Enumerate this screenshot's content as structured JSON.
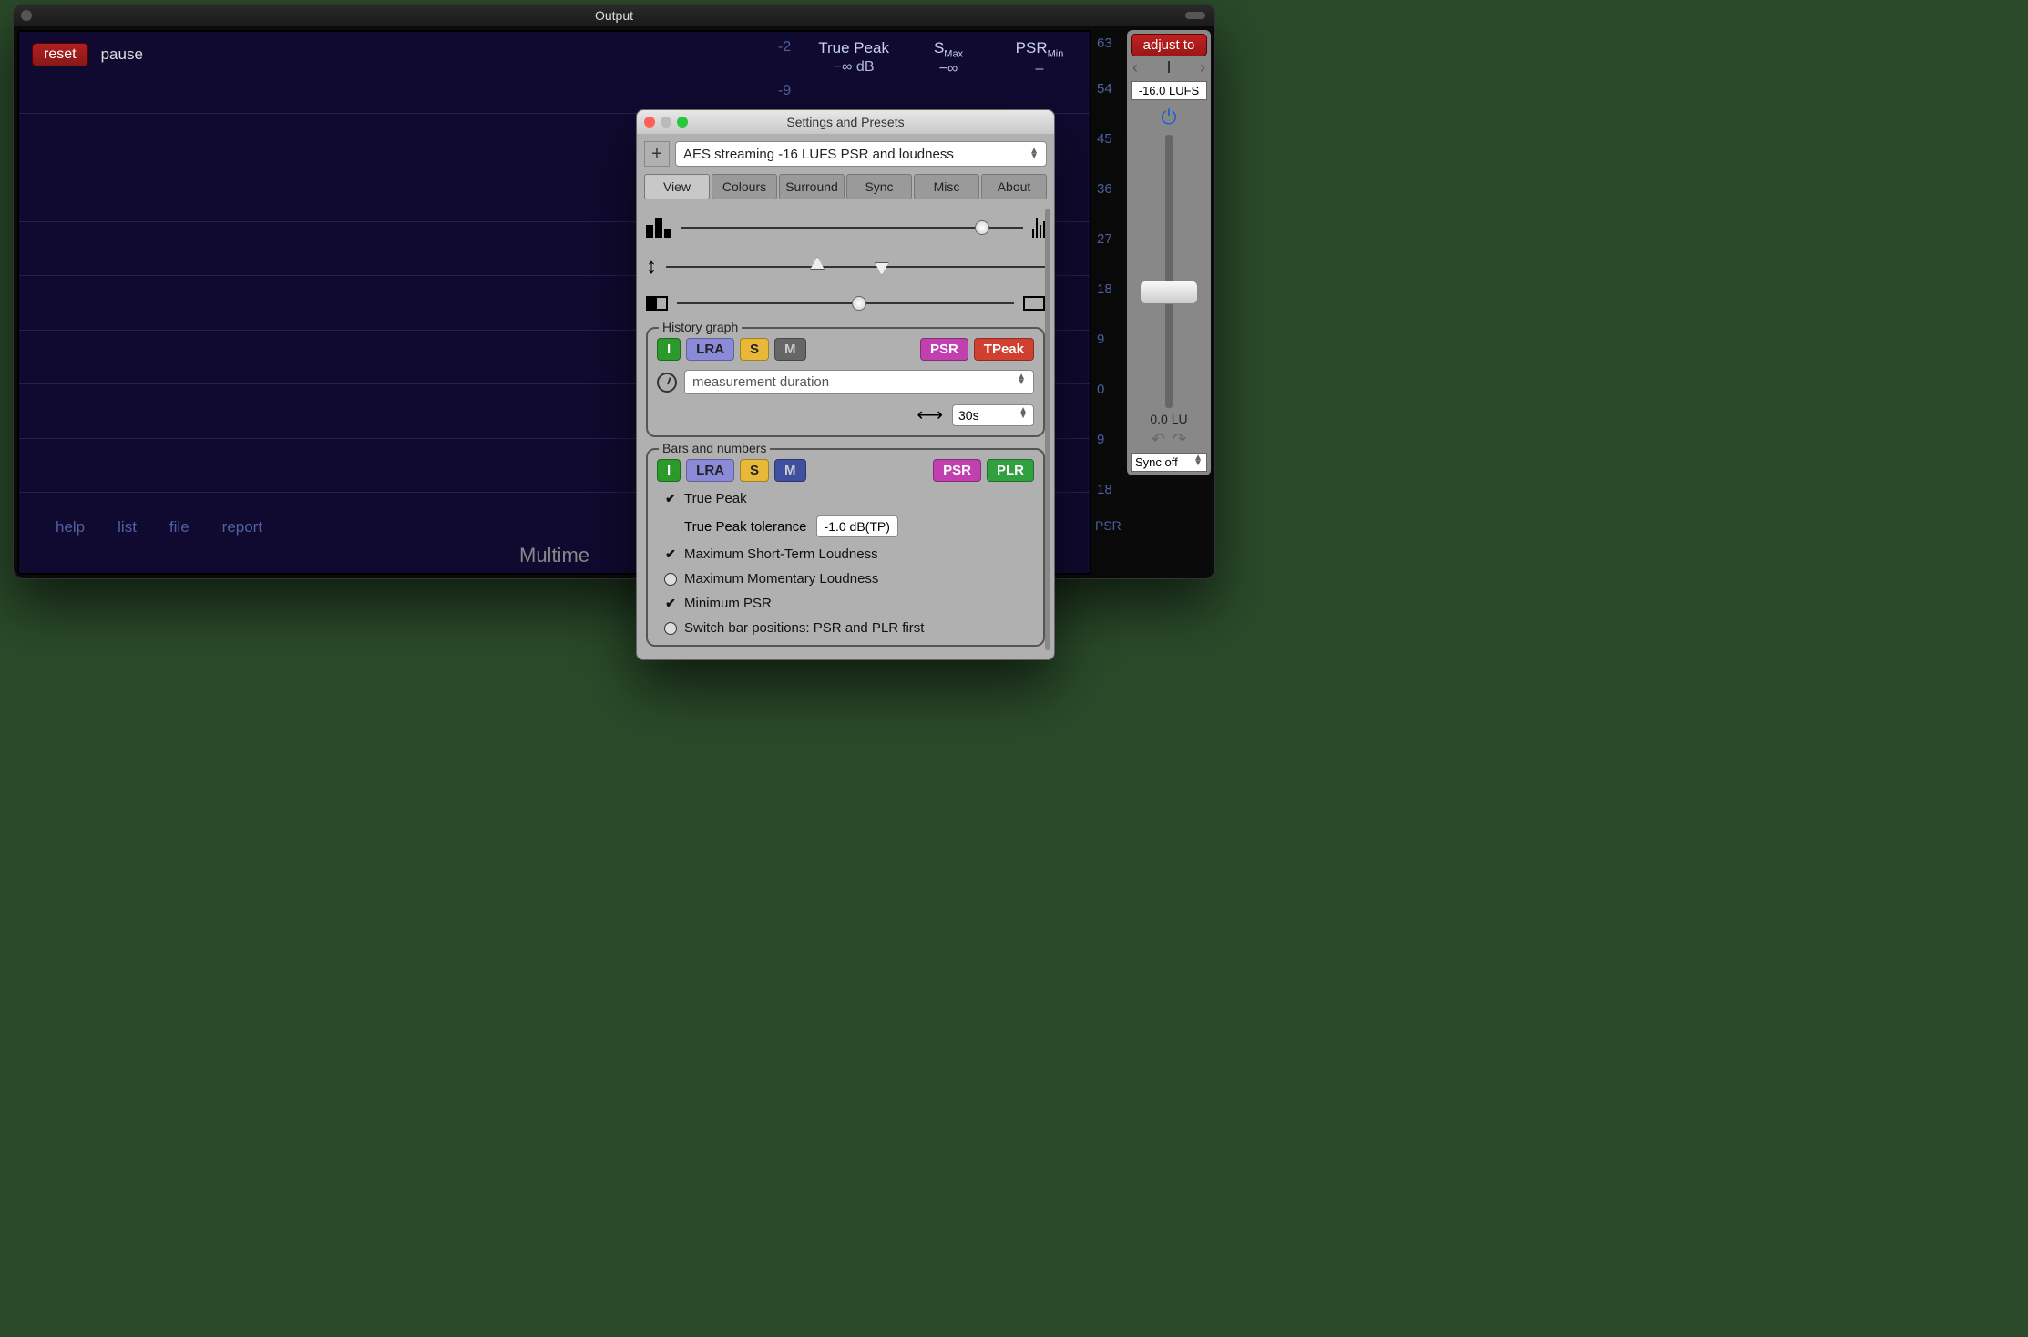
{
  "window": {
    "title": "Output"
  },
  "toolbar": {
    "reset": "reset",
    "pause": "pause"
  },
  "readouts": {
    "scale_top": "-2",
    "scale_second": "-9",
    "true_peak": {
      "label": "True Peak",
      "value": "−∞ dB"
    },
    "s_max": {
      "label": "S",
      "sub": "Max",
      "value": "−∞"
    },
    "psr_min": {
      "label": "PSR",
      "sub": "Min",
      "value": "–"
    }
  },
  "right_scale": [
    "63",
    "54",
    "45",
    "36",
    "27",
    "18",
    "9",
    "0",
    "9",
    "18"
  ],
  "psr_label": "PSR",
  "bottom_links": [
    "help",
    "list",
    "file",
    "report"
  ],
  "brand": "Multime",
  "adjust": {
    "button": "adjust to",
    "mode": "I",
    "target": "-16.0 LUFS",
    "lu": "0.0 LU",
    "sync": "Sync off"
  },
  "settings": {
    "title": "Settings and Presets",
    "preset": "AES streaming -16 LUFS PSR and loudness",
    "tabs": [
      "View",
      "Colours",
      "Surround",
      "Sync",
      "Misc",
      "About"
    ],
    "active_tab": "View",
    "history": {
      "legend": "History graph",
      "chips": {
        "i": "I",
        "lra": "LRA",
        "s": "S",
        "m": "M",
        "psr": "PSR",
        "tpeak": "TPeak"
      },
      "duration_placeholder": "measurement duration",
      "width": "30s"
    },
    "bars": {
      "legend": "Bars and numbers",
      "chips": {
        "i": "I",
        "lra": "LRA",
        "s": "S",
        "m": "M",
        "psr": "PSR",
        "plr": "PLR"
      },
      "true_peak": "True Peak",
      "tp_tolerance_label": "True Peak tolerance",
      "tp_tolerance_value": "-1.0 dB(TP)",
      "max_short": "Maximum Short-Term Loudness",
      "max_momentary": "Maximum Momentary Loudness",
      "min_psr": "Minimum PSR",
      "switch_bars": "Switch bar positions: PSR and PLR first"
    }
  }
}
